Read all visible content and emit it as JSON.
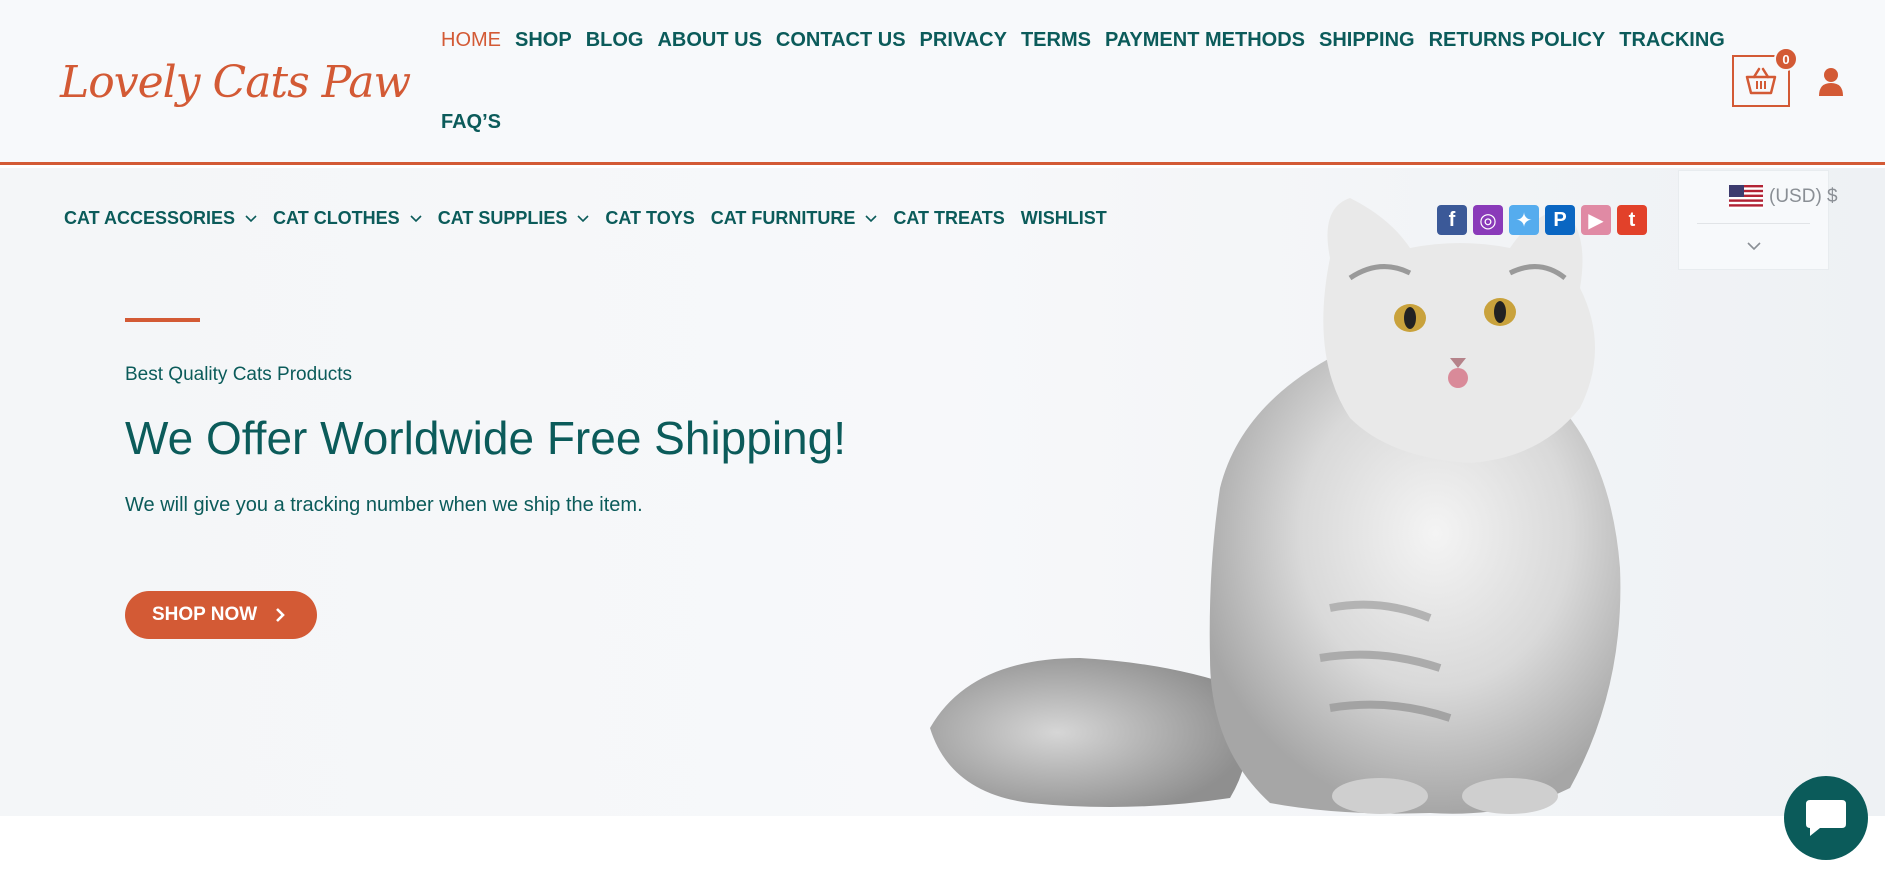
{
  "brand": {
    "name": "Lovely Cats Paw",
    "primary_color": "#d35a35",
    "secondary_color": "#0b5b5a"
  },
  "header": {
    "nav": [
      {
        "label": "HOME",
        "active": true
      },
      {
        "label": "SHOP"
      },
      {
        "label": "BLOG"
      },
      {
        "label": "ABOUT US"
      },
      {
        "label": "CONTACT US"
      },
      {
        "label": "PRIVACY"
      },
      {
        "label": "TERMS"
      },
      {
        "label": "PAYMENT METHODS"
      },
      {
        "label": "SHIPPING"
      },
      {
        "label": "RETURNS POLICY"
      },
      {
        "label": "TRACKING"
      },
      {
        "label": "FAQ’S"
      }
    ],
    "cart": {
      "count": "0",
      "icon": "basket-icon"
    },
    "account_icon": "user-icon"
  },
  "category_nav": [
    {
      "label": "CAT ACCESSORIES",
      "dropdown": true
    },
    {
      "label": "CAT CLOTHES",
      "dropdown": true
    },
    {
      "label": "CAT SUPPLIES",
      "dropdown": true
    },
    {
      "label": "CAT TOYS",
      "dropdown": false
    },
    {
      "label": "CAT FURNITURE",
      "dropdown": true
    },
    {
      "label": "CAT TREATS",
      "dropdown": false
    },
    {
      "label": "WISHLIST",
      "dropdown": false
    }
  ],
  "social": [
    {
      "name": "facebook-icon",
      "glyph": "f",
      "color": "#3b5998"
    },
    {
      "name": "instagram-icon",
      "glyph": "◎",
      "color": "#8a3ab9"
    },
    {
      "name": "twitter-icon",
      "glyph": "✦",
      "color": "#55acee"
    },
    {
      "name": "pinterest-icon",
      "glyph": "P",
      "color": "#0a66c2"
    },
    {
      "name": "youtube-icon",
      "glyph": "▶",
      "color": "#e08aa4"
    },
    {
      "name": "tumblr-icon",
      "glyph": "t",
      "color": "#e2412a"
    }
  ],
  "currency": {
    "label": "(USD) $",
    "flag": "us-flag-icon"
  },
  "hero": {
    "eyebrow": "Best Quality Cats Products",
    "headline": "We Offer Worldwide Free Shipping!",
    "subtext": "We will give you a tracking number when we ship the item.",
    "cta": "SHOP NOW"
  },
  "chat": {
    "icon": "chat-bubble-icon"
  }
}
